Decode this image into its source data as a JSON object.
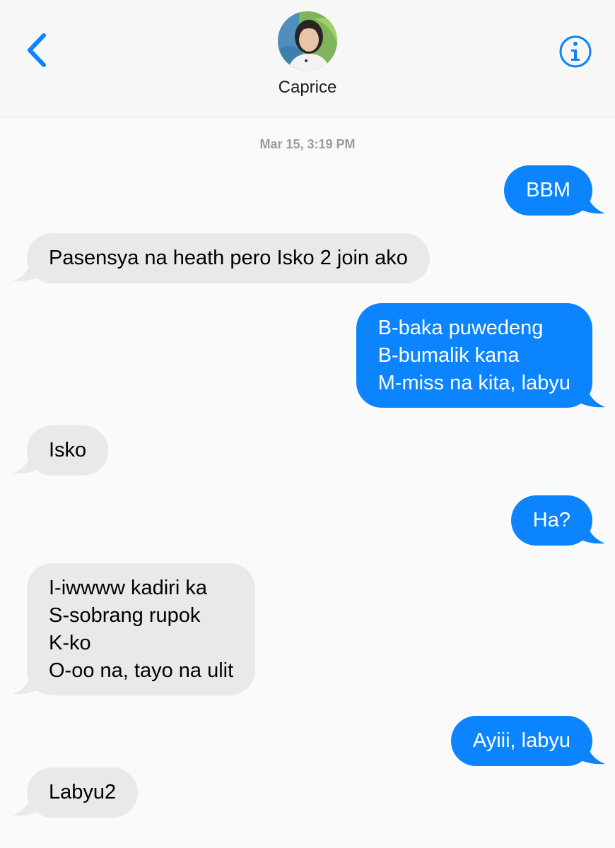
{
  "header": {
    "contact_name": "Caprice",
    "back_icon": "chevron-left-icon",
    "info_icon": "info-circle-icon",
    "accent_color": "#0b84fe"
  },
  "conversation": {
    "timestamp": "Mar 15, 3:19 PM",
    "messages": [
      {
        "sender": "me",
        "text": "BBM"
      },
      {
        "sender": "contact",
        "text": "Pasensya na heath pero Isko 2 join ako"
      },
      {
        "sender": "me",
        "text": "B-baka puwedeng\nB-bumalik kana\nM-miss na kita, labyu"
      },
      {
        "sender": "contact",
        "text": "Isko"
      },
      {
        "sender": "me",
        "text": "Ha?"
      },
      {
        "sender": "contact",
        "text": "I-iwwww kadiri ka\nS-sobrang rupok\nK-ko\nO-oo na, tayo na ulit"
      },
      {
        "sender": "me",
        "text": "Ayiii, labyu"
      },
      {
        "sender": "contact",
        "text": "Labyu2"
      }
    ]
  },
  "colors": {
    "outgoing_bubble": "#0b84fe",
    "incoming_bubble": "#e9e9eb"
  }
}
